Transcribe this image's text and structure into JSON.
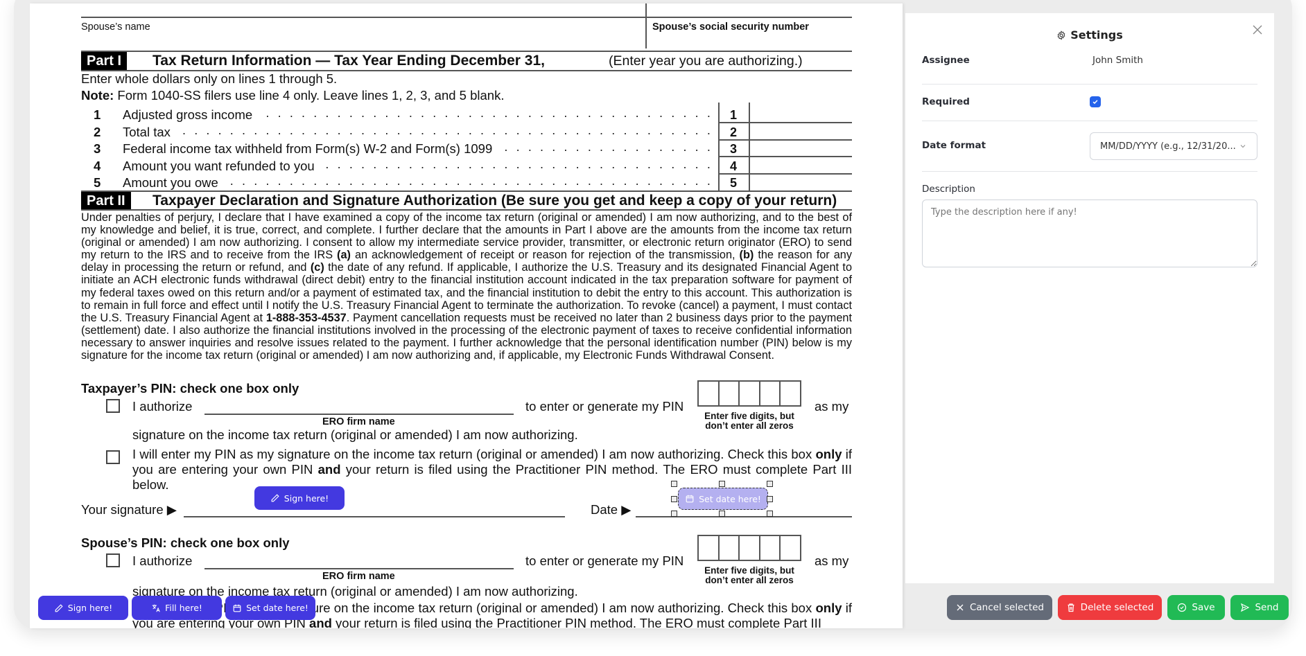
{
  "document": {
    "spouse_name_label": "Spouse’s name",
    "spouse_ssn_label": "Spouse’s social security number",
    "part1": {
      "tag": "Part I",
      "title": "Tax Return Information — Tax Year Ending December 31,",
      "year_hint": "(Enter year you are authorizing.)",
      "instruction": "Enter whole dollars only on lines 1 through 5.",
      "note_bold": "Note:",
      "note_text": " Form 1040-SS filers use line 4 only. Leave lines 1, 2, 3, and 5 blank.",
      "lines": [
        {
          "num": "1",
          "label": "Adjusted gross income"
        },
        {
          "num": "2",
          "label": "Total tax"
        },
        {
          "num": "3",
          "label": "Federal income tax withheld from Form(s) W-2 and Form(s) 1099"
        },
        {
          "num": "4",
          "label": "Amount you want refunded to you"
        },
        {
          "num": "5",
          "label": "Amount you owe"
        }
      ]
    },
    "part2": {
      "tag": "Part II",
      "title": "Taxpayer Declaration and Signature Authorization (Be sure you get and keep a copy of your return)",
      "declaration": {
        "s1": "Under penalties of perjury, I declare that I have examined a copy of the income tax return (original or amended) I am now authorizing, and to the best of my knowledge and belief, it is true, correct, and complete. I further declare that the amounts in Part I above are the amounts from the income tax return (original or amended) I am now authorizing. I consent to allow my intermediate service provider, transmitter, or electronic return originator (ERO) to send my return to the IRS and to receive from the IRS ",
        "a": "(a)",
        "s2": " an acknowledgement of receipt or reason for rejection of the transmission, ",
        "b": "(b)",
        "s3": " the reason for any delay in processing the return or refund, and ",
        "c": "(c)",
        "s4": " the date of any refund. If applicable, I authorize the U.S. Treasury and its designated Financial Agent to initiate an ACH electronic funds withdrawal (direct debit) entry to the financial institution account indicated in the tax preparation software for payment of my federal taxes owed on this return and/or a payment of estimated tax, and the financial institution to debit the entry to this account. This authorization is to remain in full force and effect until I notify the U.S. Treasury Financial Agent to terminate the authorization. To revoke (cancel) a payment, I must contact the U.S. Treasury Financial Agent at ",
        "phone": "1-888-353-4537",
        "s5": ". Payment cancellation requests must be received no later than 2 business days prior to the payment (settlement) date. I also authorize the financial institutions involved in the processing of the electronic payment of taxes to receive confidential information necessary to answer inquiries and resolve issues related to the payment. I further acknowledge that the personal identification number (PIN) below is my signature for the income tax return (original or amended) I am now authorizing and, if applicable, my Electronic Funds Withdrawal Consent."
      }
    },
    "taxpayer_pin": {
      "heading": "Taxpayer’s PIN: check one box only",
      "authorize": "I authorize",
      "ero_label": "ERO firm name",
      "to_enter": "to enter or generate my PIN",
      "as_my": "as my",
      "pin_note_1": "Enter five digits, but",
      "pin_note_2": "don’t enter all zeros",
      "signature_line": "signature on the income tax return (original or amended) I am now authorizing.",
      "option2_a": "I will enter my PIN as my signature on the income tax return (original or amended) I am now authorizing. Check this box ",
      "option2_only": "only",
      "option2_b": "if you are entering your own PIN ",
      "option2_and": "and",
      "option2_c": " your return is filed using the Practitioner PIN method. The ERO must complete Part III",
      "option2_d": "below.",
      "your_signature": "Your signature ▶",
      "date": "Date ▶"
    },
    "spouse_pin": {
      "heading": "Spouse’s PIN: check one box only",
      "authorize": "I authorize",
      "ero_label": "ERO firm name",
      "to_enter": "to enter or generate my PIN",
      "as_my": "as my",
      "pin_note_1": "Enter five digits, but",
      "pin_note_2": "don’t enter all zeros",
      "signature_line": "signature on the income tax return (original or amended) I am now authorizing.",
      "option2_a": "I will enter my PIN as my signature on the income tax return (original or amended) I am now authorizing. Check this box ",
      "option2_only": "only",
      "option2_b": "if you are entering your own PIN ",
      "option2_and": "and",
      "option2_c": " your return is filed using the Practitioner PIN method. The ERO must complete Part III"
    }
  },
  "fields": {
    "sign_here": "Sign here!",
    "set_date_selected": "Set date here!"
  },
  "toolbar": {
    "sign_here": "Sign here!",
    "fill_here": "Fill here!",
    "set_date_here": "Set date here!"
  },
  "settings": {
    "title": "Settings",
    "assignee_label": "Assignee",
    "assignee_value": "John Smith",
    "required_label": "Required",
    "required_checked": true,
    "date_format_label": "Date format",
    "date_format_value": "MM/DD/YYYY (e.g., 12/31/20...",
    "description_label": "Description",
    "description_placeholder": "Type the description here if any!",
    "description_value": ""
  },
  "actions": {
    "cancel_selected": "Cancel selected",
    "delete_selected": "Delete selected",
    "save": "Save",
    "send": "Send"
  },
  "colors": {
    "primary": "#4339e0",
    "cancel": "#646b78",
    "delete": "#ef3b3e",
    "save": "#21ba55",
    "send": "#21ba55",
    "checkbox": "#2563eb"
  }
}
